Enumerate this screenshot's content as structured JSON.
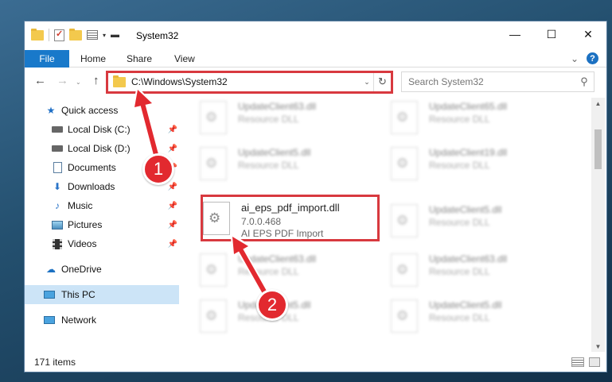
{
  "window": {
    "title": "System32",
    "minimize_glyph": "—",
    "maximize_glyph": "☐",
    "close_glyph": "✕"
  },
  "ribbon": {
    "tabs": [
      "File",
      "Home",
      "Share",
      "View"
    ],
    "expand_glyph": "⌄",
    "help_glyph": "?"
  },
  "navigation": {
    "back_glyph": "←",
    "forward_glyph": "→",
    "recent_glyph": "⌄",
    "up_glyph": "↑",
    "address": "C:\\Windows\\System32",
    "dropdown_glyph": "⌄",
    "refresh_glyph": "↻",
    "search_placeholder": "Search System32",
    "search_glyph": "⚲"
  },
  "sidebar": {
    "items": [
      {
        "label": "Quick access",
        "icon": "quick-access-star-icon"
      },
      {
        "label": "Local Disk (C:)",
        "icon": "local-disk-icon",
        "pinned": true
      },
      {
        "label": "Local Disk (D:)",
        "icon": "local-disk-icon",
        "pinned": true
      },
      {
        "label": "Documents",
        "icon": "documents-icon",
        "pinned": true
      },
      {
        "label": "Downloads",
        "icon": "downloads-icon",
        "pinned": true
      },
      {
        "label": "Music",
        "icon": "music-icon",
        "pinned": true
      },
      {
        "label": "Pictures",
        "icon": "pictures-icon",
        "pinned": true
      },
      {
        "label": "Videos",
        "icon": "videos-icon",
        "pinned": true
      },
      {
        "label": "OneDrive",
        "icon": "onedrive-icon"
      },
      {
        "label": "This PC",
        "icon": "this-pc-icon",
        "selected": true
      },
      {
        "label": "Network",
        "icon": "network-icon"
      }
    ],
    "pin_glyph": "📌"
  },
  "files": [
    {
      "name": "UpdateClient63.dll",
      "type": "Resource DLL"
    },
    {
      "name": "UpdateClient65.dll",
      "type": "Resource DLL"
    },
    {
      "name": "UpdateClient5.dll",
      "type": "Resource DLL"
    },
    {
      "name": "UpdateClient19.dll",
      "type": "Resource DLL"
    },
    {
      "name": "ai_eps_pdf_import.dll",
      "version": "7.0.0.468",
      "type": "AI EPS PDF Import"
    },
    {
      "name": "UpdateClient5.dll",
      "type": "Resource DLL"
    },
    {
      "name": "UpdateClient63.dll",
      "type": "Resource DLL"
    },
    {
      "name": "UpdateClient63.dll",
      "type": "Resource DLL"
    },
    {
      "name": "UpdateClient5.dll",
      "type": "Resource DLL"
    },
    {
      "name": "UpdateClient5.dll",
      "type": "Resource DLL"
    }
  ],
  "status": {
    "item_count": "171 items"
  },
  "annotations": {
    "step1": "1",
    "step2": "2",
    "color": "#e2292f"
  }
}
